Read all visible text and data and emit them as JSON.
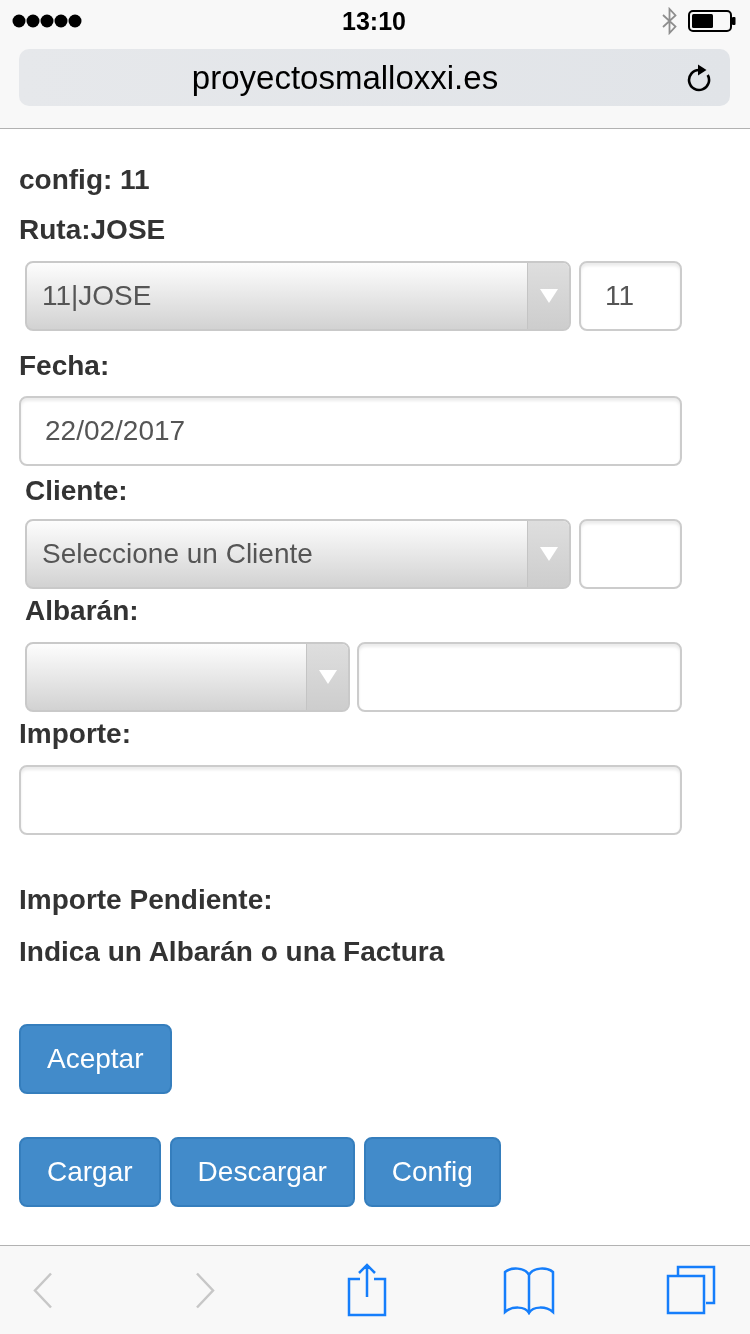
{
  "status_bar": {
    "time": "13:10"
  },
  "address_bar": {
    "url": "proyectosmalloxxi.es"
  },
  "config_title": "config: 11",
  "route": {
    "label": "Ruta:JOSE",
    "select": "11|JOSE",
    "code": "11"
  },
  "date": {
    "label": "Fecha:",
    "value": "22/02/2017"
  },
  "client": {
    "label": "Cliente:",
    "select": "Seleccione un Cliente"
  },
  "delivery_note": {
    "label": "Albarán:"
  },
  "amount": {
    "label": "Importe:"
  },
  "pending_amount": {
    "label": "Importe Pendiente:"
  },
  "message": "Indica un Albarán o una Factura",
  "submit_button": "Aceptar",
  "action_buttons": [
    "Cargar",
    "Descargar",
    "Config"
  ],
  "toolbar": [
    {
      "kind": "back",
      "disabled": true
    },
    {
      "kind": "forward",
      "disabled": true
    },
    {
      "kind": "share",
      "disabled": false
    },
    {
      "kind": "bookmarks",
      "disabled": false
    },
    {
      "kind": "tabs",
      "disabled": false
    }
  ]
}
